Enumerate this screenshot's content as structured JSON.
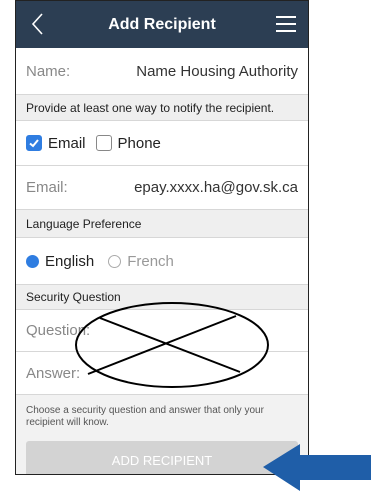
{
  "header": {
    "title": "Add Recipient",
    "back_icon": "chevron-left-icon",
    "menu_icon": "hamburger-menu-icon"
  },
  "name_row": {
    "label": "Name:",
    "value": "Name Housing Authority"
  },
  "notify_section": {
    "label": "Provide at least one way to notify the recipient."
  },
  "notify_options": {
    "email": {
      "label": "Email",
      "checked": true
    },
    "phone": {
      "label": "Phone",
      "checked": false
    }
  },
  "email_row": {
    "label": "Email:",
    "value": "epay.xxxx.ha@gov.sk.ca"
  },
  "language_section": {
    "label": "Language Preference"
  },
  "language_options": {
    "english": {
      "label": "English",
      "selected": true
    },
    "french": {
      "label": "French",
      "selected": false
    }
  },
  "security_section": {
    "label": "Security Question"
  },
  "security_fields": {
    "question_label": "Question:",
    "answer_label": "Answer:"
  },
  "hint": "Choose a security question and answer that only your recipient will know.",
  "submit_button": {
    "label": "ADD RECIPIENT"
  },
  "colors": {
    "header": "#2c3e53",
    "accent": "#2f7de1",
    "disabled_button": "#d3d3d3",
    "annotation_arrow": "#1f5ea8"
  }
}
